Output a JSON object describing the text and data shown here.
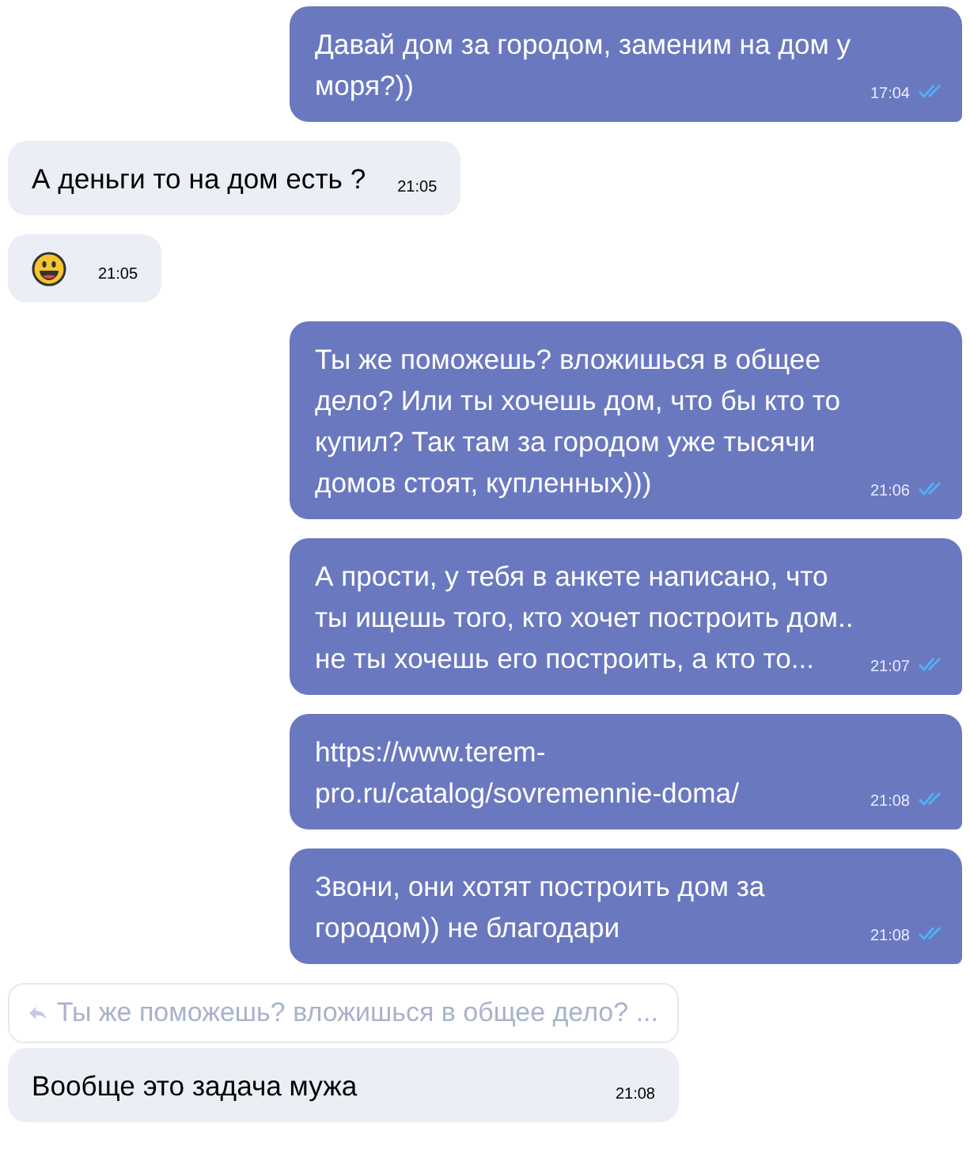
{
  "messages": [
    {
      "outgoing": true,
      "kind": "text",
      "text": "Давай дом за городом, заменим на дом у моря?))",
      "time": "17:04",
      "read": true
    },
    {
      "outgoing": false,
      "kind": "text",
      "text": "А деньги то на дом есть ?",
      "time": "21:05"
    },
    {
      "outgoing": false,
      "kind": "emoji",
      "time": "21:05"
    },
    {
      "outgoing": true,
      "kind": "text",
      "text": "Ты же поможешь? вложишься в общее дело? Или ты хочешь дом, что бы кто то купил? Так там за городом уже тысячи домов стоят, купленных)))",
      "time": "21:06",
      "read": true
    },
    {
      "outgoing": true,
      "kind": "text",
      "text": "А прости, у тебя в анкете написано, что ты ищешь того, кто хочет построить дом.. не ты хочешь его построить, а кто то...",
      "time": "21:07",
      "read": true
    },
    {
      "outgoing": true,
      "kind": "text",
      "text": "https://www.terem-pro.ru/catalog/sovremennie-doma/",
      "time": "21:08",
      "read": true
    },
    {
      "outgoing": true,
      "kind": "text",
      "text": "Звони, они хотят построить дом за городом)) не благодари",
      "time": "21:08",
      "read": true
    },
    {
      "outgoing": false,
      "kind": "text",
      "reply_to": "Ты же поможешь? вложишься в общее дело? ...",
      "text": "Вообще это задача мужа",
      "time": "21:08"
    }
  ]
}
